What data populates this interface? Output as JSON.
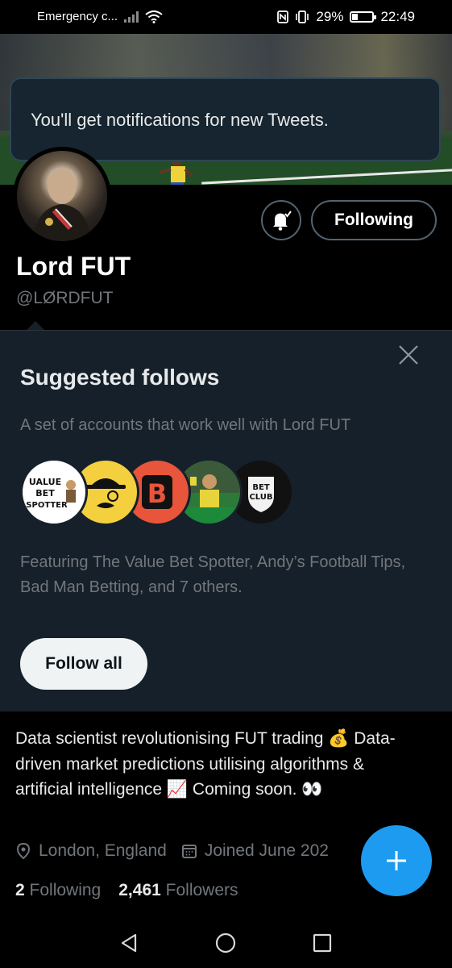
{
  "status_bar": {
    "carrier": "Emergency c...",
    "battery": "29%",
    "battery_level": 0.29,
    "time": "22:49"
  },
  "toast": {
    "message": "You'll get notifications for new Tweets."
  },
  "profile": {
    "name": "Lord FUT",
    "handle": "@LØRDFUT",
    "following_button": "Following",
    "bio": "Data scientist revolutionising FUT trading 💰 Data-driven market predictions utilising algorithms & artificial intelligence 📈 Coming soon. 👀",
    "location": "London, England",
    "joined": "Joined June 202",
    "following_count": "2",
    "following_label": "Following",
    "followers_count": "2,461",
    "followers_label": "Followers"
  },
  "suggested": {
    "title": "Suggested follows",
    "subtitle": "A set of accounts that work well with Lord FUT",
    "description": "Featuring The Value Bet Spotter, Andy’s Football Tips, Bad Man Betting, and 7 others.",
    "follow_all": "Follow all",
    "avatar_texts": {
      "value_bet": [
        "UALUE",
        "BET",
        "SPOTTER"
      ],
      "bet_club": [
        "BET",
        "CLUB"
      ],
      "bad_man": "B"
    }
  },
  "icons": [
    "signal-icon",
    "wifi-icon",
    "nfc-icon",
    "vibrate-icon",
    "battery-icon",
    "bell-check-icon",
    "close-icon",
    "location-icon",
    "calendar-icon",
    "compose-plus-icon",
    "back-icon",
    "home-icon",
    "recents-icon"
  ],
  "colors": {
    "accent": "#1d9bf0",
    "panel": "#16202a",
    "muted": "#71767b"
  }
}
